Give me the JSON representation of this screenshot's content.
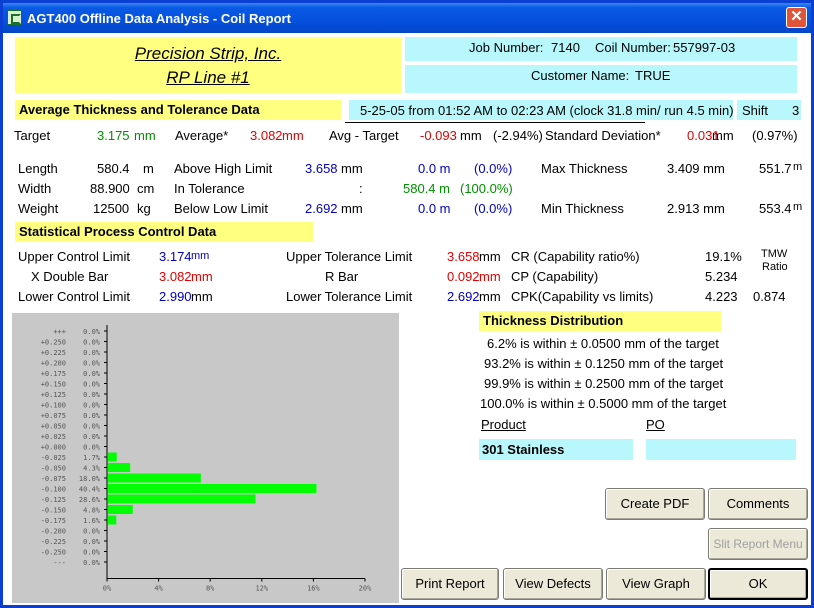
{
  "window": {
    "title": "AGT400 Offline Data Analysis - Coil Report"
  },
  "header": {
    "company": "Precision Strip, Inc.",
    "line": "RP Line #1",
    "job_number_label": "Job Number:",
    "job_number": "7140",
    "coil_number_label": "Coil Number:",
    "coil_number": "557997-03",
    "customer_label": "Customer Name:",
    "customer": "TRUE"
  },
  "avg": {
    "section_title": "Average Thickness and Tolerance Data",
    "period": "5-25-05 from 01:52 AM to 02:23 AM (clock 31.8 min/ run 4.5 min)",
    "shift_label": "Shift",
    "shift": "3",
    "target_label": "Target",
    "target": "3.175",
    "target_unit": "mm",
    "average_label": "Average*",
    "average": "3.082",
    "average_unit": "mm",
    "avg_target_label": "Avg - Target",
    "avg_target": "-0.093",
    "avg_target_unit": "mm",
    "avg_target_pct": "(-2.94%)",
    "stddev_label": "Standard Deviation*",
    "stddev": "0.031",
    "stddev_unit": "mm",
    "stddev_pct": "(0.97%)",
    "length_label": "Length",
    "length": "580.4",
    "length_unit": "m",
    "width_label": "Width",
    "width": "88.900",
    "width_unit": "cm",
    "weight_label": "Weight",
    "weight": "12500",
    "weight_unit": "kg",
    "above_label": "Above High Limit",
    "above_val": "3.658",
    "above_unit": "mm",
    "above_len": "0.0 m",
    "above_pct": "(0.0%)",
    "intol_label": "In Tolerance",
    "intol_colon": ":",
    "intol_len": "580.4 m",
    "intol_pct": "(100.0%)",
    "below_label": "Below Low Limit",
    "below_val": "2.692",
    "below_unit": "mm",
    "below_len": "0.0 m",
    "below_pct": "(0.0%)",
    "max_label": "Max Thickness",
    "max_val": "3.409 mm",
    "max_pos": "551.7",
    "max_pos_unit": "m",
    "min_label": "Min Thickness",
    "min_val": "2.913 mm",
    "min_pos": "553.4",
    "min_pos_unit": "m"
  },
  "spc": {
    "section_title": "Statistical Process Control Data",
    "ucl_label": "Upper Control Limit",
    "ucl": "3.174",
    "ucl_unit": "mm",
    "xbar_label": "X Double Bar",
    "xbar": "3.082",
    "xbar_unit": "mm",
    "lcl_label": "Lower Control Limit",
    "lcl": "2.990",
    "lcl_unit": "mm",
    "utl_label": "Upper Tolerance Limit",
    "utl": "3.658",
    "utl_unit": "mm",
    "rbar_label": "R Bar",
    "rbar": "0.092",
    "rbar_unit": "mm",
    "ltl_label": "Lower Tolerance Limit",
    "ltl": "2.692",
    "ltl_unit": "mm",
    "cr_label": "CR  (Capability ratio%)",
    "cr": "19.1%",
    "cp_label": "CP  (Capability)",
    "cp": "5.234",
    "cpk_label": "CPK(Capability vs limits)",
    "cpk": "4.223",
    "tmw_label1": "TMW",
    "tmw_label2": "Ratio",
    "tmw": "0.874"
  },
  "distribution": {
    "title": "Thickness Distribution",
    "lines": [
      "6.2% is within ± 0.0500 mm of the target",
      "93.2% is within ± 0.1250 mm of the target",
      "99.9% is within ± 0.2500 mm of the target",
      "100.0% is within ± 0.5000 mm of the target"
    ],
    "product_label": "Product",
    "po_label": "PO",
    "product": "301 Stainless",
    "po": ""
  },
  "buttons": {
    "create_pdf": "Create PDF",
    "comments": "Comments",
    "slit_report": "Slit Report Menu",
    "print_report": "Print Report",
    "view_defects": "View Defects",
    "view_graph": "View Graph",
    "ok": "OK"
  },
  "colors": {
    "bar": "#00ff00",
    "yellow": "#ffff80",
    "cyan": "#b8f8fc"
  },
  "chart_data": {
    "type": "bar",
    "orientation": "horizontal",
    "categories": [
      "+++",
      "+0.250",
      "+0.225",
      "+0.200",
      "+0.175",
      "+0.150",
      "+0.125",
      "+0.100",
      "+0.075",
      "+0.050",
      "+0.025",
      "+0.000",
      "-0.025",
      "-0.050",
      "-0.075",
      "-0.100",
      "-0.125",
      "-0.150",
      "-0.175",
      "-0.200",
      "-0.225",
      "-0.250",
      "---"
    ],
    "value_labels": [
      "0.0%",
      "0.0%",
      "0.0%",
      "0.0%",
      "0.0%",
      "0.0%",
      "0.0%",
      "0.0%",
      "0.0%",
      "0.0%",
      "0.0%",
      "0.0%",
      "1.7%",
      "4.3%",
      "18.0%",
      "40.4%",
      "28.6%",
      "4.8%",
      "1.6%",
      "0.0%",
      "0.0%",
      "0.0%",
      "0.0%"
    ],
    "values": [
      0,
      0,
      0,
      0,
      0,
      0,
      0,
      0,
      0,
      0,
      0,
      0,
      1.7,
      4.3,
      18.0,
      40.4,
      28.6,
      4.8,
      1.6,
      0,
      0,
      0,
      0
    ],
    "xlim": [
      0,
      20
    ],
    "xticks": [
      "0%",
      "4%",
      "8%",
      "12%",
      "16%",
      "20%"
    ],
    "scale": 0.4
  }
}
